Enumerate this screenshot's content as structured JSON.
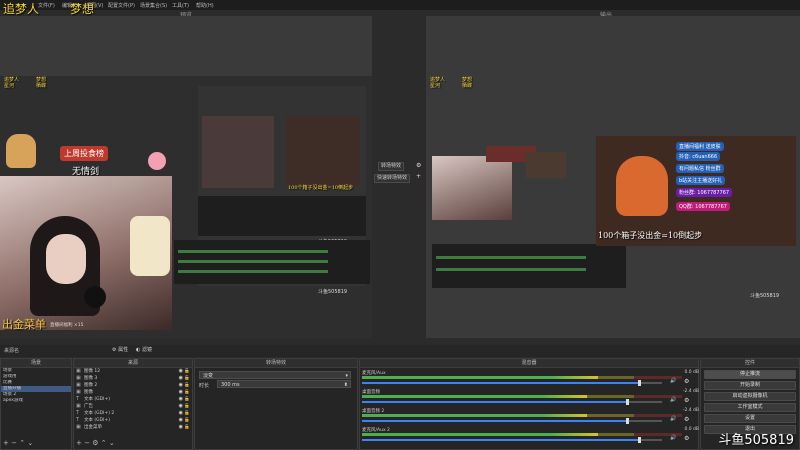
{
  "menu": {
    "items": [
      "文件(F)",
      "编辑(E)",
      "视图(V)",
      "配置文件(P)",
      "场景集合(S)",
      "工具(T)",
      "帮助(H)"
    ]
  },
  "studio": {
    "preview_label": "预览",
    "program_label": "输出"
  },
  "overlay": {
    "top_left_1": "追梦人",
    "top_left_2": "星河",
    "top_mid_1": "梦想",
    "top_mid_2": "栖蝶",
    "small_1": "追梦人",
    "small_2": "星河",
    "small_3": "梦想",
    "small_4": "栖蝶",
    "promo_1": "上周投食榜",
    "promo_2": "无情剑",
    "bottom_left": "出金菜单",
    "bottom_left_sub": "直播间福利 ×15",
    "box_text": "100个箱子没出金=10倒起步",
    "box_text_small": "100个箱子没出金=10倒起步",
    "room_id": "斗鱼505819",
    "room_id_small": "斗鱼505819",
    "fan_group": "粉丝群: 1067787767",
    "qq_group": "QQ群: 1067787767",
    "tips_1": "直播间福利 送皮肤",
    "tips_2": "抖音: c6uan666",
    "tips_3": "有问题私信 粉丝群",
    "tips_4": "b站关注主播送好礼"
  },
  "transition_mid": {
    "btn1": "转场特效",
    "btn2": "快速转场特效"
  },
  "scenes": {
    "title": "场景",
    "items": [
      "场景",
      "游戏用",
      "比赛",
      "直播开播",
      "场景 2",
      "apex游戏"
    ],
    "selected": 3
  },
  "sources": {
    "title": "来源",
    "items": [
      "图像 12",
      "图像 3",
      "图像 2",
      "图像",
      "文本 (GDI+)",
      "广告",
      "文本 (GDI+) 2",
      "文本 (GDI+)",
      "出金菜单"
    ]
  },
  "scene_transitions": {
    "title": "转场特效",
    "type": "淡变",
    "duration_label": "时长",
    "duration_value": "300 ms"
  },
  "mixer": {
    "title": "混音器",
    "channels": [
      {
        "name": "麦克风/Aux",
        "db": "0.0 dB",
        "level": 0.92
      },
      {
        "name": "桌面音频",
        "db": "-2.4 dB",
        "level": 0.88
      },
      {
        "name": "桌面音频 2",
        "db": "-2.4 dB",
        "level": 0.88
      },
      {
        "name": "麦克风/Aux 2",
        "db": "0.0 dB",
        "level": 0.92
      }
    ]
  },
  "controls": {
    "title": "控件",
    "buttons": [
      "停止推流",
      "开始录制",
      "启动虚拟摄像机",
      "工作室模式",
      "设置",
      "退出"
    ]
  },
  "below_preview": {
    "left_label": "来源名",
    "btn1": "属性",
    "btn2": "滤镜"
  },
  "watermark": "斗鱼505819"
}
